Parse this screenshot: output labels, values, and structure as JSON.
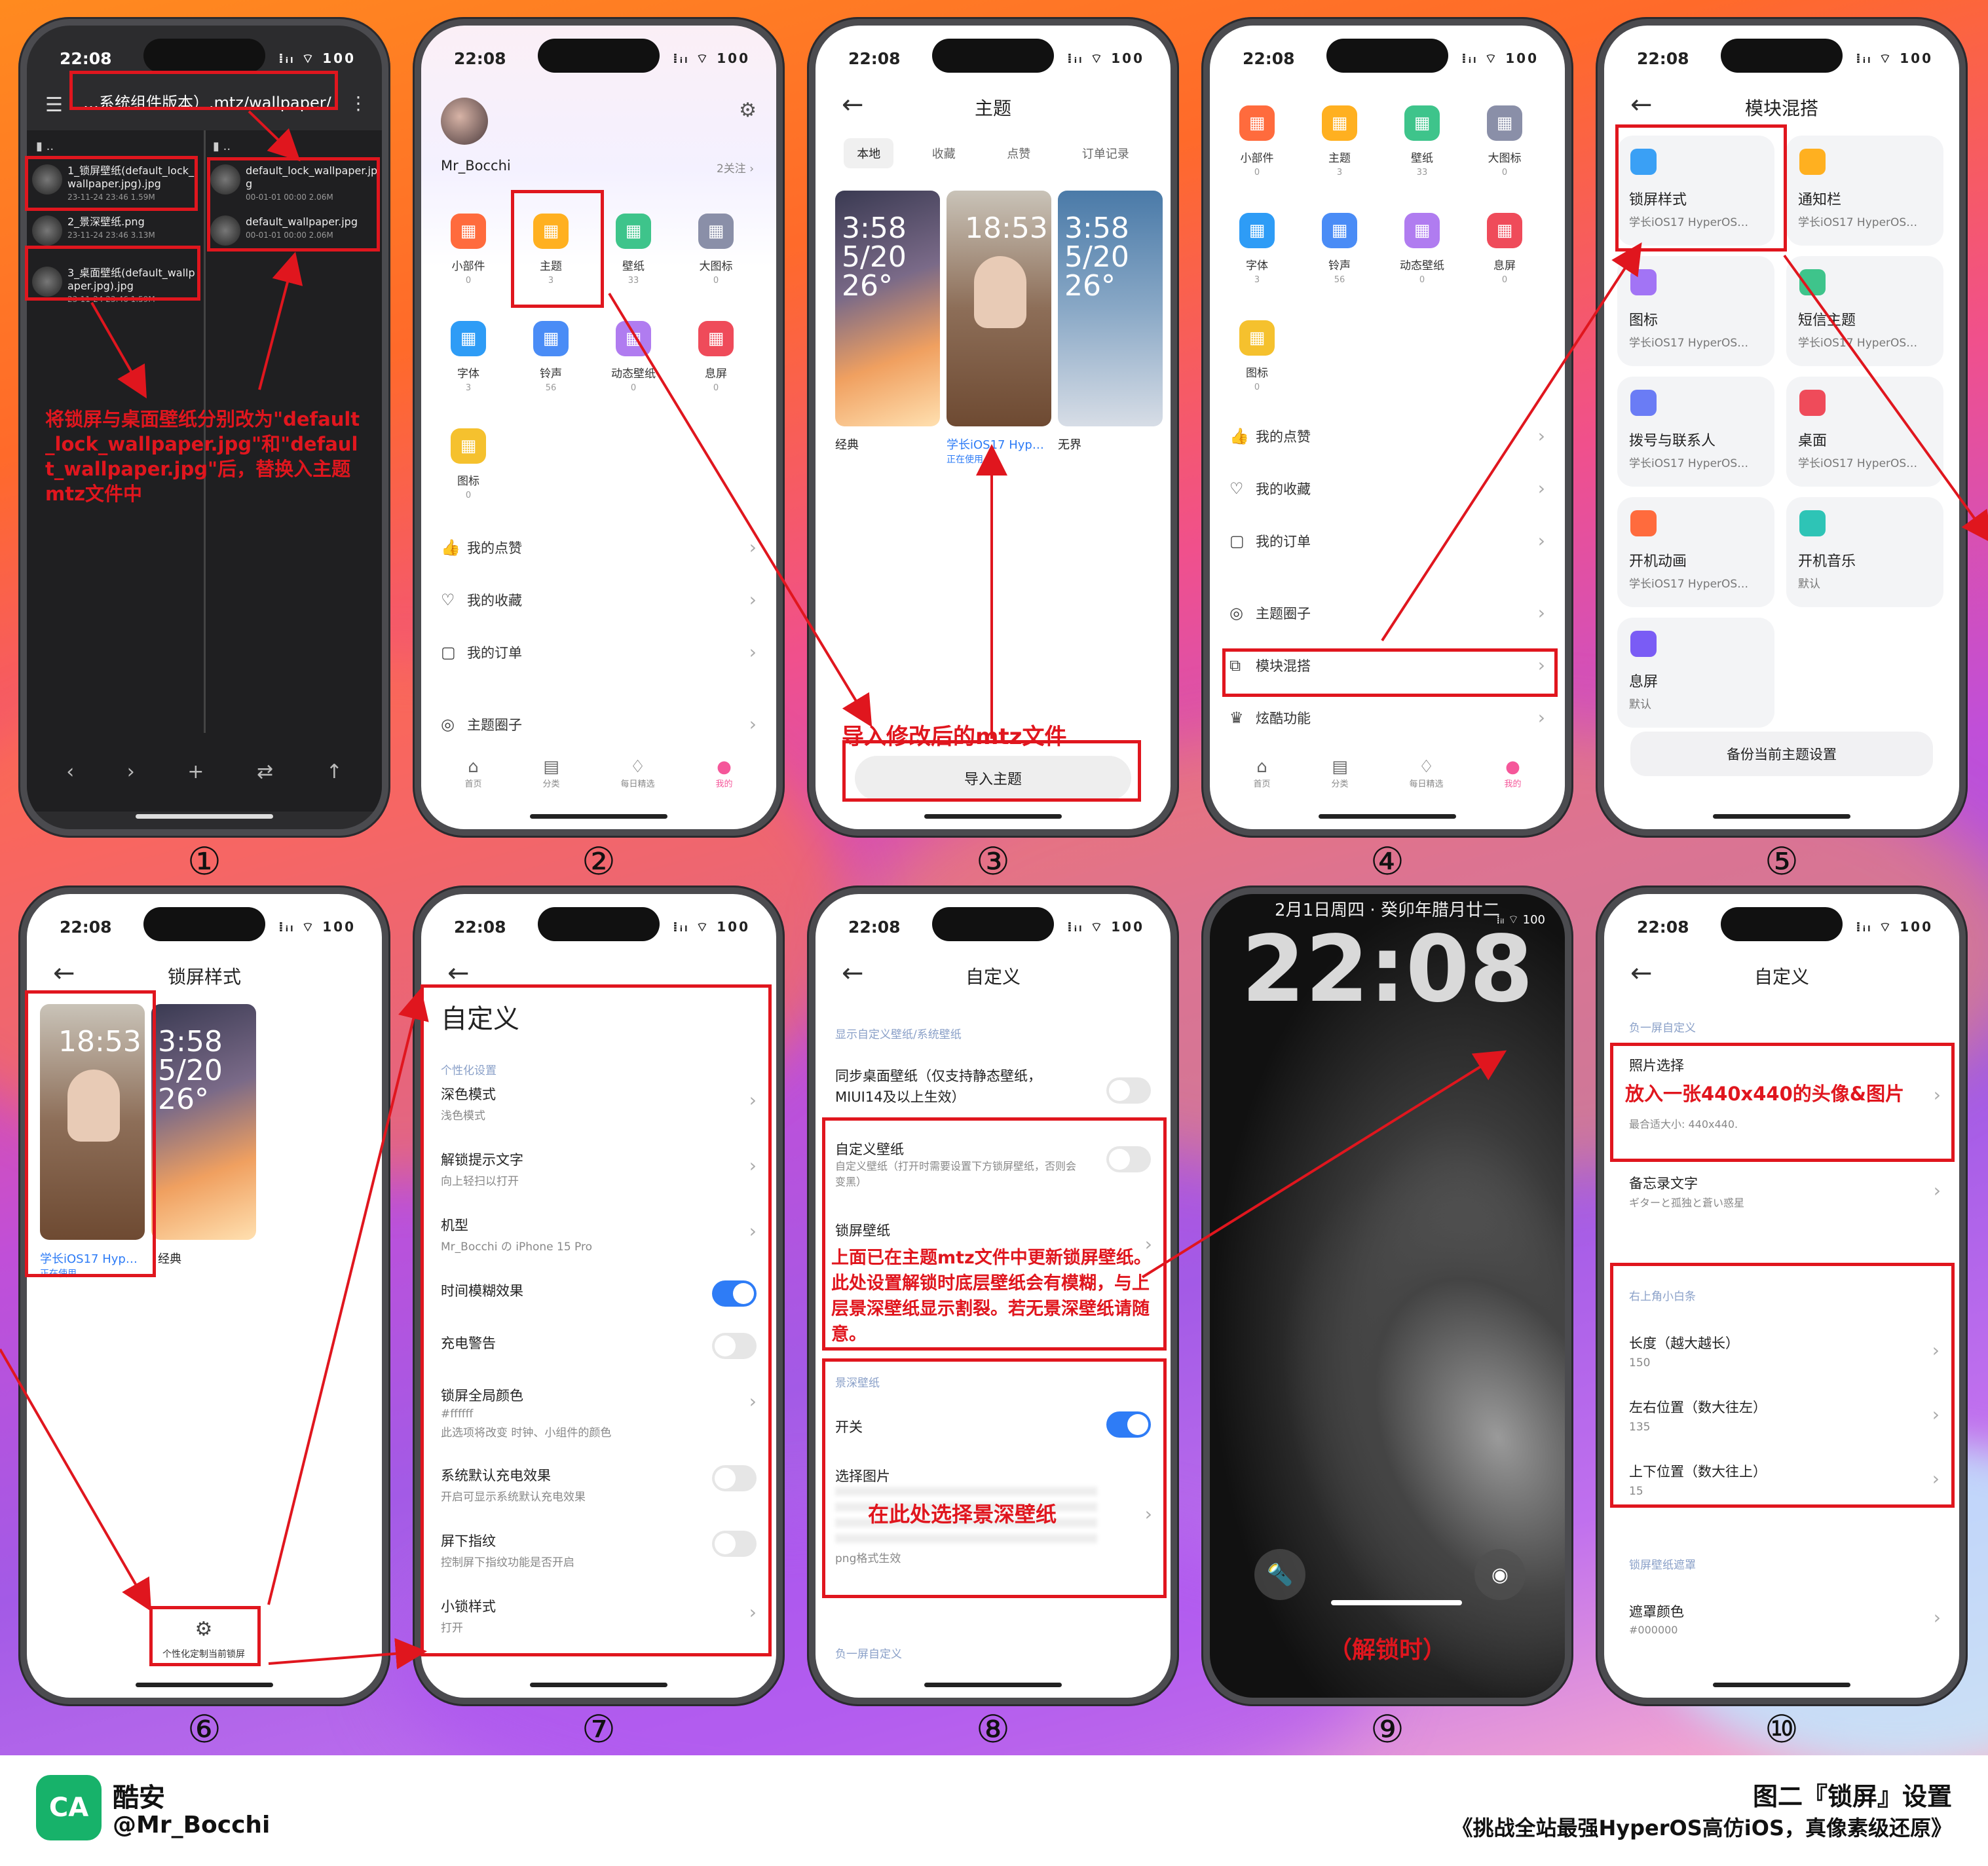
{
  "time": "22:08",
  "status_right": "⁞ᵢₗ ⌔ 100",
  "numbers": [
    "①",
    "②",
    "③",
    "④",
    "⑤",
    "⑥",
    "⑦",
    "⑧",
    "⑨",
    "⑩"
  ],
  "p1": {
    "path": "…系统组件版本）.mtz/wallpaper/",
    "dots": "..",
    "left_files": [
      {
        "name": "1_锁屏壁纸(default_lock_wallpaper.jpg).jpg",
        "meta": "23-11-24 23:46  1.59M"
      },
      {
        "name": "2_景深壁纸.png",
        "meta": "23-11-24 23:46  3.13M"
      },
      {
        "name": "3_桌面壁纸(default_wallpaper.jpg).jpg",
        "meta": "23-11-24 23:46  1.59M"
      }
    ],
    "right_files": [
      {
        "name": "default_lock_wallpaper.jpg",
        "meta": "00-01-01 00:00  2.06M"
      },
      {
        "name": "default_wallpaper.jpg",
        "meta": "00-01-01 00:00  2.06M"
      }
    ],
    "note": "将锁屏与桌面壁纸分别改为\"default_lock_wallpaper.jpg\"和\"default_wallpaper.jpg\"后，替换入主题mtz文件中",
    "toolbar": [
      "‹",
      "›",
      "+",
      "⇄",
      "↑"
    ]
  },
  "p2": {
    "user": "Mr_Bocchi",
    "follow": "2关注 ›",
    "grid": [
      {
        "label": "小部件",
        "count": "0",
        "color": "#ff6b3d"
      },
      {
        "label": "主题",
        "count": "3",
        "color": "#ffb020"
      },
      {
        "label": "壁纸",
        "count": "33",
        "color": "#3ec48b"
      },
      {
        "label": "大图标",
        "count": "0",
        "color": "#8a8fa8"
      },
      {
        "label": "字体",
        "count": "3",
        "color": "#2e9cf6"
      },
      {
        "label": "铃声",
        "count": "56",
        "color": "#4a8cf6"
      },
      {
        "label": "动态壁纸",
        "count": "0",
        "color": "#b07cf0"
      },
      {
        "label": "息屏",
        "count": "0",
        "color": "#ef4b5a"
      },
      {
        "label": "图标",
        "count": "0",
        "color": "#f5c12e"
      }
    ],
    "menu": [
      "我的点赞",
      "我的收藏",
      "我的订单",
      "主题圈子"
    ],
    "tabs": [
      "首页",
      "分类",
      "每日精选",
      "我的"
    ]
  },
  "p3": {
    "title": "主题",
    "tabs": [
      "本地",
      "收藏",
      "点赞",
      "订单记录"
    ],
    "themes": [
      {
        "name": "经典",
        "state": ""
      },
      {
        "name": "学长iOS17 Hyp…",
        "state": "正在使用"
      },
      {
        "name": "无界",
        "state": ""
      }
    ],
    "note": "导入修改后的mtz文件",
    "button": "导入主题"
  },
  "p4": {
    "grid": [
      {
        "label": "小部件",
        "count": "0",
        "color": "#ff6b3d"
      },
      {
        "label": "主题",
        "count": "3",
        "color": "#ffb020"
      },
      {
        "label": "壁纸",
        "count": "33",
        "color": "#3ec48b"
      },
      {
        "label": "大图标",
        "count": "0",
        "color": "#8a8fa8"
      },
      {
        "label": "字体",
        "count": "3",
        "color": "#2e9cf6"
      },
      {
        "label": "铃声",
        "count": "56",
        "color": "#4a8cf6"
      },
      {
        "label": "动态壁纸",
        "count": "0",
        "color": "#b07cf0"
      },
      {
        "label": "息屏",
        "count": "0",
        "color": "#ef4b5a"
      },
      {
        "label": "图标",
        "count": "0",
        "color": "#f5c12e"
      }
    ],
    "menu": [
      "我的点赞",
      "我的收藏",
      "我的订单",
      "主题圈子",
      "模块混搭",
      "炫酷功能"
    ],
    "tabs": [
      "首页",
      "分类",
      "每日精选",
      "我的"
    ]
  },
  "p5": {
    "title": "模块混搭",
    "cards": [
      {
        "t": "锁屏样式",
        "s": "学长iOS17 HyperOS…",
        "c": "#3aa0f5"
      },
      {
        "t": "通知栏",
        "s": "学长iOS17 HyperOS…",
        "c": "#ffb020"
      },
      {
        "t": "图标",
        "s": "学长iOS17 HyperOS…",
        "c": "#a274f5"
      },
      {
        "t": "短信主题",
        "s": "学长iOS17 HyperOS…",
        "c": "#3ec48b"
      },
      {
        "t": "拨号与联系人",
        "s": "学长iOS17 HyperOS…",
        "c": "#6a7cf5"
      },
      {
        "t": "桌面",
        "s": "学长iOS17 HyperOS…",
        "c": "#ef4b5a"
      },
      {
        "t": "开机动画",
        "s": "学长iOS17 HyperOS…",
        "c": "#ff6b3d"
      },
      {
        "t": "开机音乐",
        "s": "默认",
        "c": "#2ec4b6"
      },
      {
        "t": "息屏",
        "s": "默认",
        "c": "#7a5cf5"
      }
    ],
    "button": "备份当前主题设置"
  },
  "p6": {
    "title": "锁屏样式",
    "themes": [
      {
        "name": "学长iOS17 Hyp…",
        "state": "正在使用"
      },
      {
        "name": "经典",
        "state": ""
      }
    ],
    "custom": "个性化定制当前锁屏"
  },
  "p7": {
    "title": "自定义",
    "section": "个性化设置",
    "rows": [
      {
        "t": "深色模式",
        "s": "浅色模式",
        "type": "chev"
      },
      {
        "t": "解锁提示文字",
        "s": "向上轻扫以打开",
        "type": "chev"
      },
      {
        "t": "机型",
        "s": "Mr_Bocchi の iPhone 15 Pro",
        "type": "chev"
      },
      {
        "t": "时间模糊效果",
        "s": "",
        "type": "on"
      },
      {
        "t": "充电警告",
        "s": "",
        "type": "off"
      },
      {
        "t": "锁屏全局颜色",
        "s": "#ffffff\n此选项将改变 时钟、小组件的颜色",
        "type": "chev"
      },
      {
        "t": "系统默认充电效果",
        "s": "开启可显示系统默认充电效果",
        "type": "off"
      },
      {
        "t": "屏下指纹",
        "s": "控制屏下指纹功能是否开启",
        "type": "off"
      },
      {
        "t": "小锁样式",
        "s": "打开",
        "type": "chev"
      }
    ]
  },
  "p8": {
    "title": "自定义",
    "section1": "显示自定义壁纸/系统壁纸",
    "sync": "同步桌面壁纸（仅支持静态壁纸，MIUI14及以上生效）",
    "custom_t": "自定义壁纸",
    "custom_s": "自定义壁纸（打开时需要设置下方锁屏壁纸，否则会变黑）",
    "lock_t": "锁屏壁纸",
    "note1": "上面已在主题mtz文件中更新锁屏壁纸。此处设置解锁时底层壁纸会有模糊，与上层景深壁纸显示割裂。若无景深壁纸请随意。",
    "section2": "景深壁纸",
    "switch": "开关",
    "pick": "选择图片",
    "note2": "在此处选择景深壁纸",
    "png": "png格式生效",
    "section3": "负一屏自定义"
  },
  "p9": {
    "date": "2月1日周四 · 癸卯年腊月廿二",
    "clock": "22:08",
    "note": "（解锁时）"
  },
  "p10": {
    "title": "自定义",
    "section1": "负一屏自定义",
    "photo_t": "照片选择",
    "photo_note": "放入一张440x440的头像&图片",
    "photo_s": "最合适大小: 440x440.",
    "memo_t": "备忘录文字",
    "memo_s": "ギターと孤独と蒼い惑星",
    "section2": "右上角小白条",
    "bars": [
      {
        "t": "长度（越大越长）",
        "v": "150"
      },
      {
        "t": "左右位置（数大往左）",
        "v": "135"
      },
      {
        "t": "上下位置（数大往上）",
        "v": "15"
      }
    ],
    "section3": "锁屏壁纸遮罩",
    "mask_t": "遮罩颜色",
    "mask_v": "#000000"
  },
  "footer": {
    "app": "酷安",
    "handle": "@Mr_Bocchi",
    "title": "图二『锁屏』设置",
    "subtitle": "《挑战全站最强HyperOS高仿iOS，真像素级还原》"
  },
  "colors": {
    "accent": "#e0161e",
    "blue": "#2e7cf6",
    "green": "#17b26a"
  }
}
